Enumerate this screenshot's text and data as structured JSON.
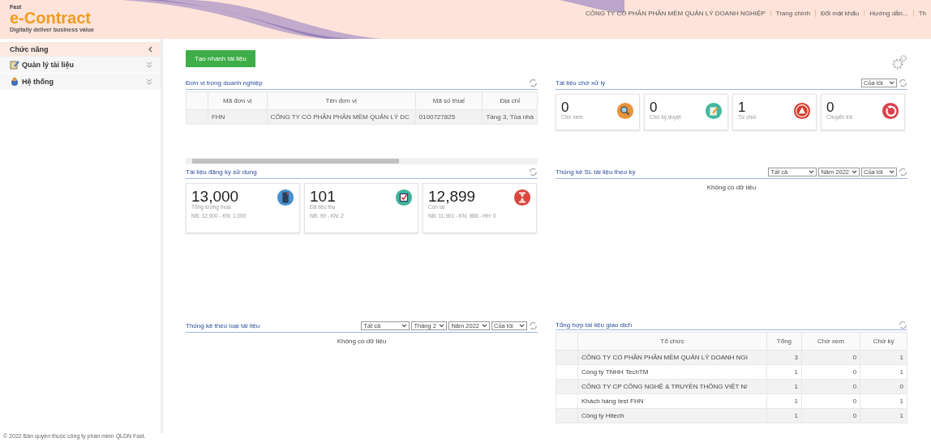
{
  "header": {
    "brand": "Fast",
    "product": "e-Contract",
    "tagline": "Digitally deliver business value",
    "company": "CÔNG TY CỔ PHẦN PHẦN MỀM QUẢN LÝ DOANH NGHIỆP",
    "links": [
      "Trang chính",
      "Đổi mật khẩu",
      "Hướng dẫn...",
      "Th"
    ]
  },
  "sidebar": {
    "title": "Chức năng",
    "items": [
      {
        "label": "Quản lý tài liệu",
        "kind": "document"
      },
      {
        "label": "Hệ thống",
        "kind": "system"
      }
    ]
  },
  "quick_button": "Tạo nhanh tài liệu",
  "units": {
    "title": "Đơn vị trong doanh nghiệp",
    "columns": [
      "Mã đơn vị",
      "Tên đơn vị",
      "Mã số thuế",
      "Địa chỉ"
    ],
    "rows": [
      [
        "FHN",
        "CÔNG TY CỔ PHẦN PHẦN MỀM QUẢN LÝ DC",
        "0100727825",
        "Tầng 3, Tòa nhà"
      ]
    ]
  },
  "pending": {
    "title": "Tài liệu chờ xử lý",
    "filters": [
      "Của tôi"
    ],
    "cards": [
      {
        "value": "0",
        "label": "Chờ xem",
        "kind": "search"
      },
      {
        "value": "0",
        "label": "Chờ ký duyệt",
        "kind": "edit"
      },
      {
        "value": "1",
        "label": "Từ chối",
        "kind": "warning"
      },
      {
        "value": "0",
        "label": "Chuyển trả",
        "kind": "return"
      }
    ]
  },
  "registered": {
    "title": "Tài liệu đăng ký sử dụng",
    "cards": [
      {
        "value": "13,000",
        "label": "Tổng lượng mua",
        "detail": "NB: 12,000 - KN: 1,000",
        "kind": "book"
      },
      {
        "value": "101",
        "label": "Đã tiêu thụ",
        "detail": "NB: 99 - KN: 2",
        "kind": "check"
      },
      {
        "value": "12,899",
        "label": "Còn lại",
        "detail": "NB: 11,901 - KN: 988 - HH: 0",
        "kind": "hourglass"
      }
    ]
  },
  "period": {
    "title": "Thống kê SL tài liệu theo kỳ",
    "filters": [
      "Tất cả",
      "Năm 2022",
      "Của tôi"
    ],
    "empty": "Không có dữ liệu"
  },
  "by_type": {
    "title": "Thống kê theo loại tài liệu",
    "filters": [
      "Tất cả",
      "Tháng 2",
      "Năm 2022",
      "Của tôi"
    ],
    "empty": "Không có dữ liệu"
  },
  "transactions": {
    "title": "Tổng hợp tài liệu giao dịch",
    "columns": [
      "Tổ chức",
      "Tổng",
      "Chờ xem",
      "Chờ ký"
    ],
    "rows": [
      [
        "CÔNG TY CỔ PHẦN PHẦN MỀM QUẢN LÝ DOANH NGI",
        "3",
        "0",
        "1"
      ],
      [
        "Công ty TNHH TechTM",
        "1",
        "0",
        "1"
      ],
      [
        "CÔNG TY CP CÔNG NGHỆ & TRUYỀN THÔNG VIỆT N/",
        "1",
        "0",
        "0"
      ],
      [
        "Khách hàng test FHN",
        "1",
        "0",
        "1"
      ],
      [
        "Công ty Hitech",
        "1",
        "0",
        "1"
      ]
    ]
  },
  "footer": "© 2022 Bản quyền thuộc công ty phần mềm QLDN Fast."
}
